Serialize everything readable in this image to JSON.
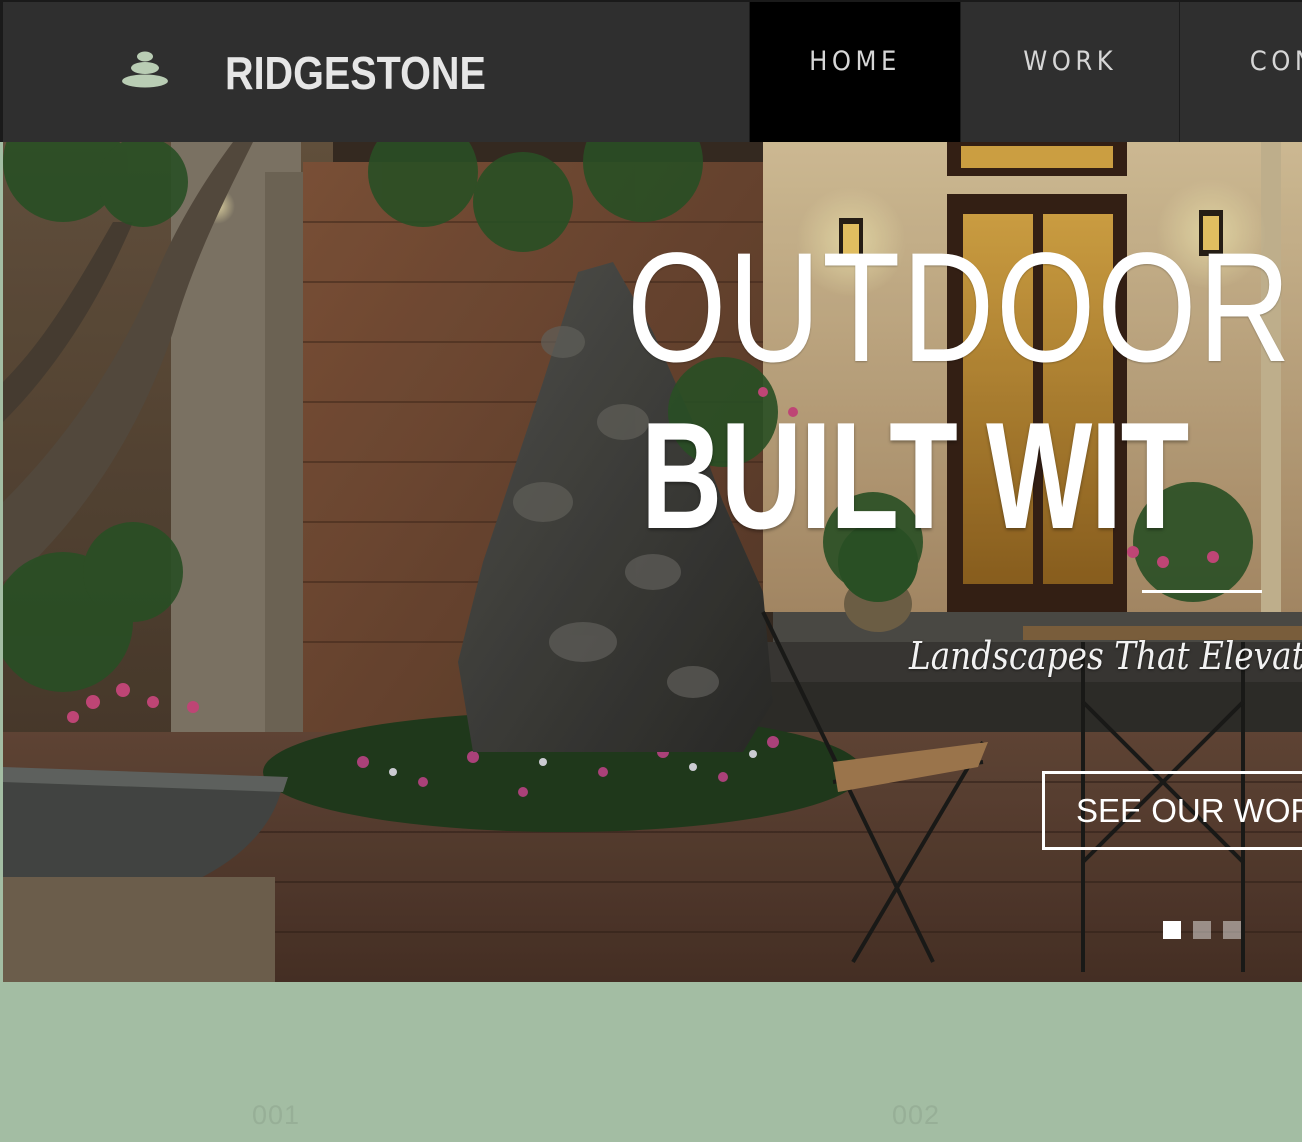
{
  "brand": {
    "name": "RIDGESTONE",
    "logo_icon": "stacked-stones-icon"
  },
  "nav": {
    "items": [
      {
        "label": "HOME",
        "active": true
      },
      {
        "label": "WORK",
        "active": false
      },
      {
        "label": "CON",
        "active": false
      }
    ]
  },
  "hero": {
    "title_line_1": "OUTDOOR S",
    "title_line_2": "BUILT WIT",
    "tagline": "Landscapes That Elevate",
    "cta_label": "SEE OUR WOR",
    "slides": {
      "count": 3,
      "active_index": 0
    }
  },
  "steps": [
    {
      "number": "001"
    },
    {
      "number": "002"
    }
  ],
  "colors": {
    "header_bg": "#2f2f2f",
    "nav_active_bg": "#000000",
    "section_bg": "#a3bda3",
    "logo_icon": "#b9cdb4",
    "text_light": "#ffffff"
  }
}
